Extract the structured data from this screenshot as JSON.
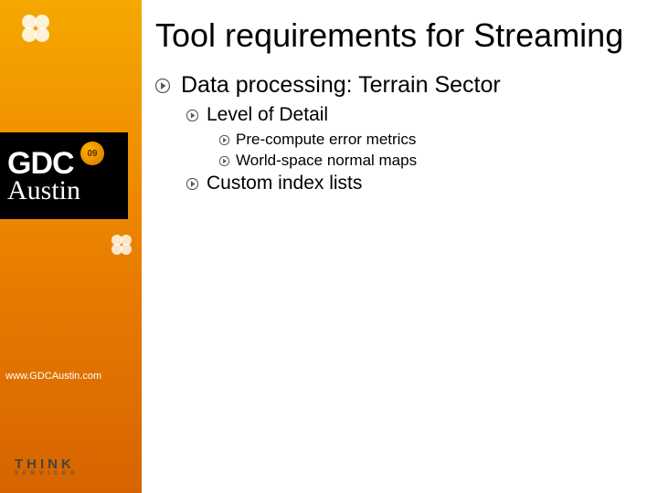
{
  "sidebar": {
    "gdc": "GDC",
    "austin": "Austin",
    "badge": "09",
    "url": "www.GDCAustin.com",
    "think": "THINK",
    "think_sub": "SERVICES"
  },
  "title": "Tool requirements for Streaming",
  "l1": "Data processing: Terrain Sector",
  "l2a": "Level of Detail",
  "l2b": "Custom index lists",
  "l3a": "Pre-compute error metrics",
  "l3b": "World-space normal maps"
}
